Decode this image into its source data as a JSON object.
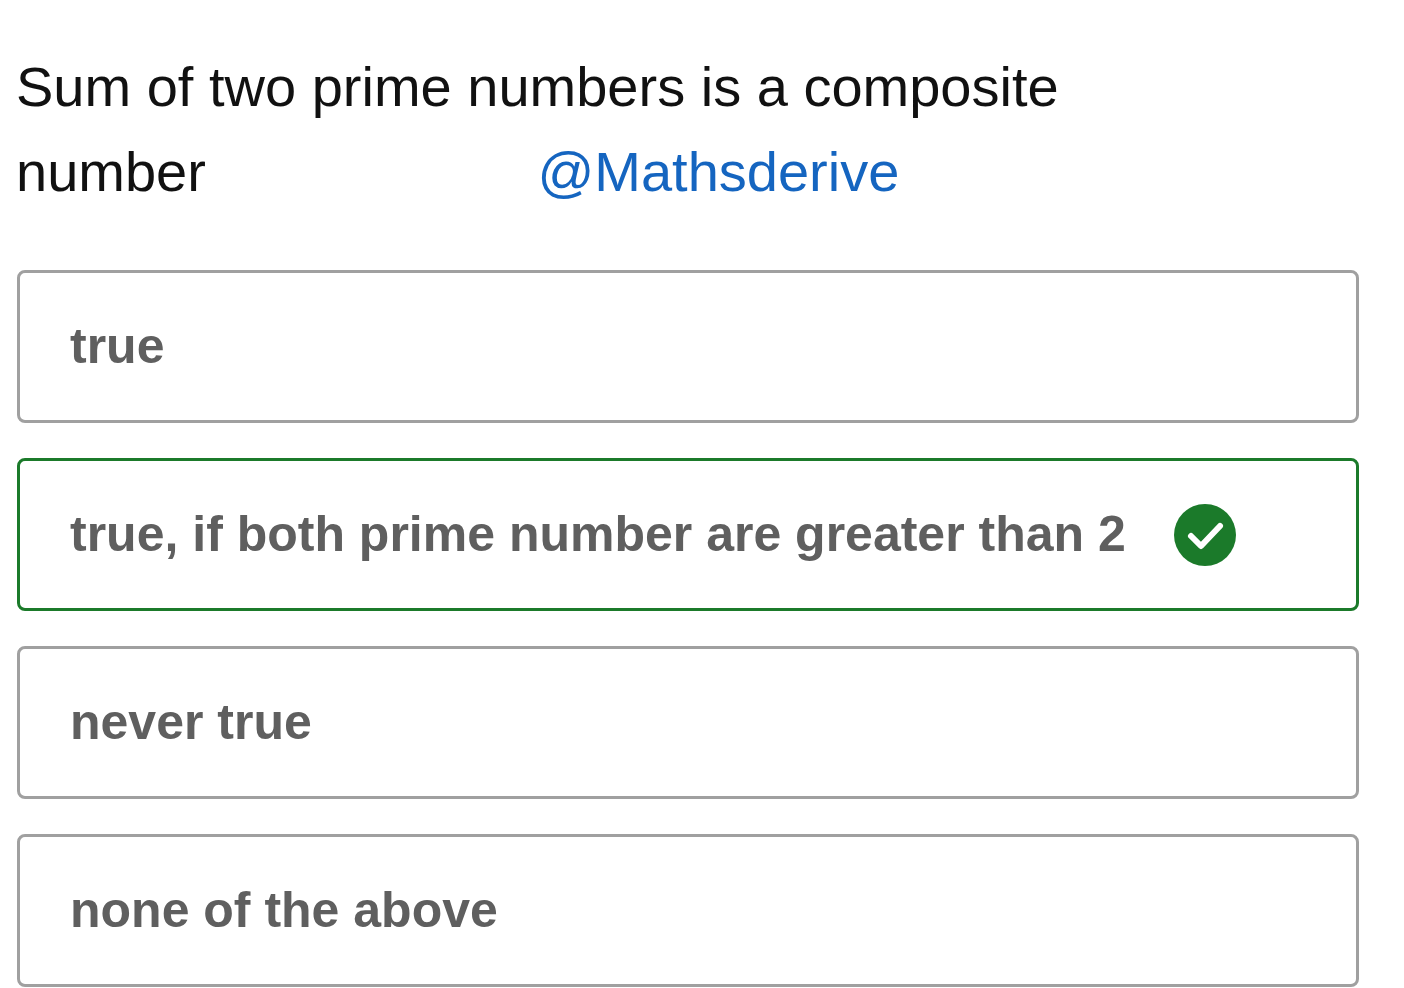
{
  "question": {
    "text": "Sum of two prime numbers is a composite number",
    "handle": "@Mathsderive"
  },
  "options": [
    {
      "label": "true",
      "selected": false
    },
    {
      "label": "true, if both prime number are greater than 2",
      "selected": true
    },
    {
      "label": "never true",
      "selected": false
    },
    {
      "label": "none of the above",
      "selected": false
    }
  ]
}
